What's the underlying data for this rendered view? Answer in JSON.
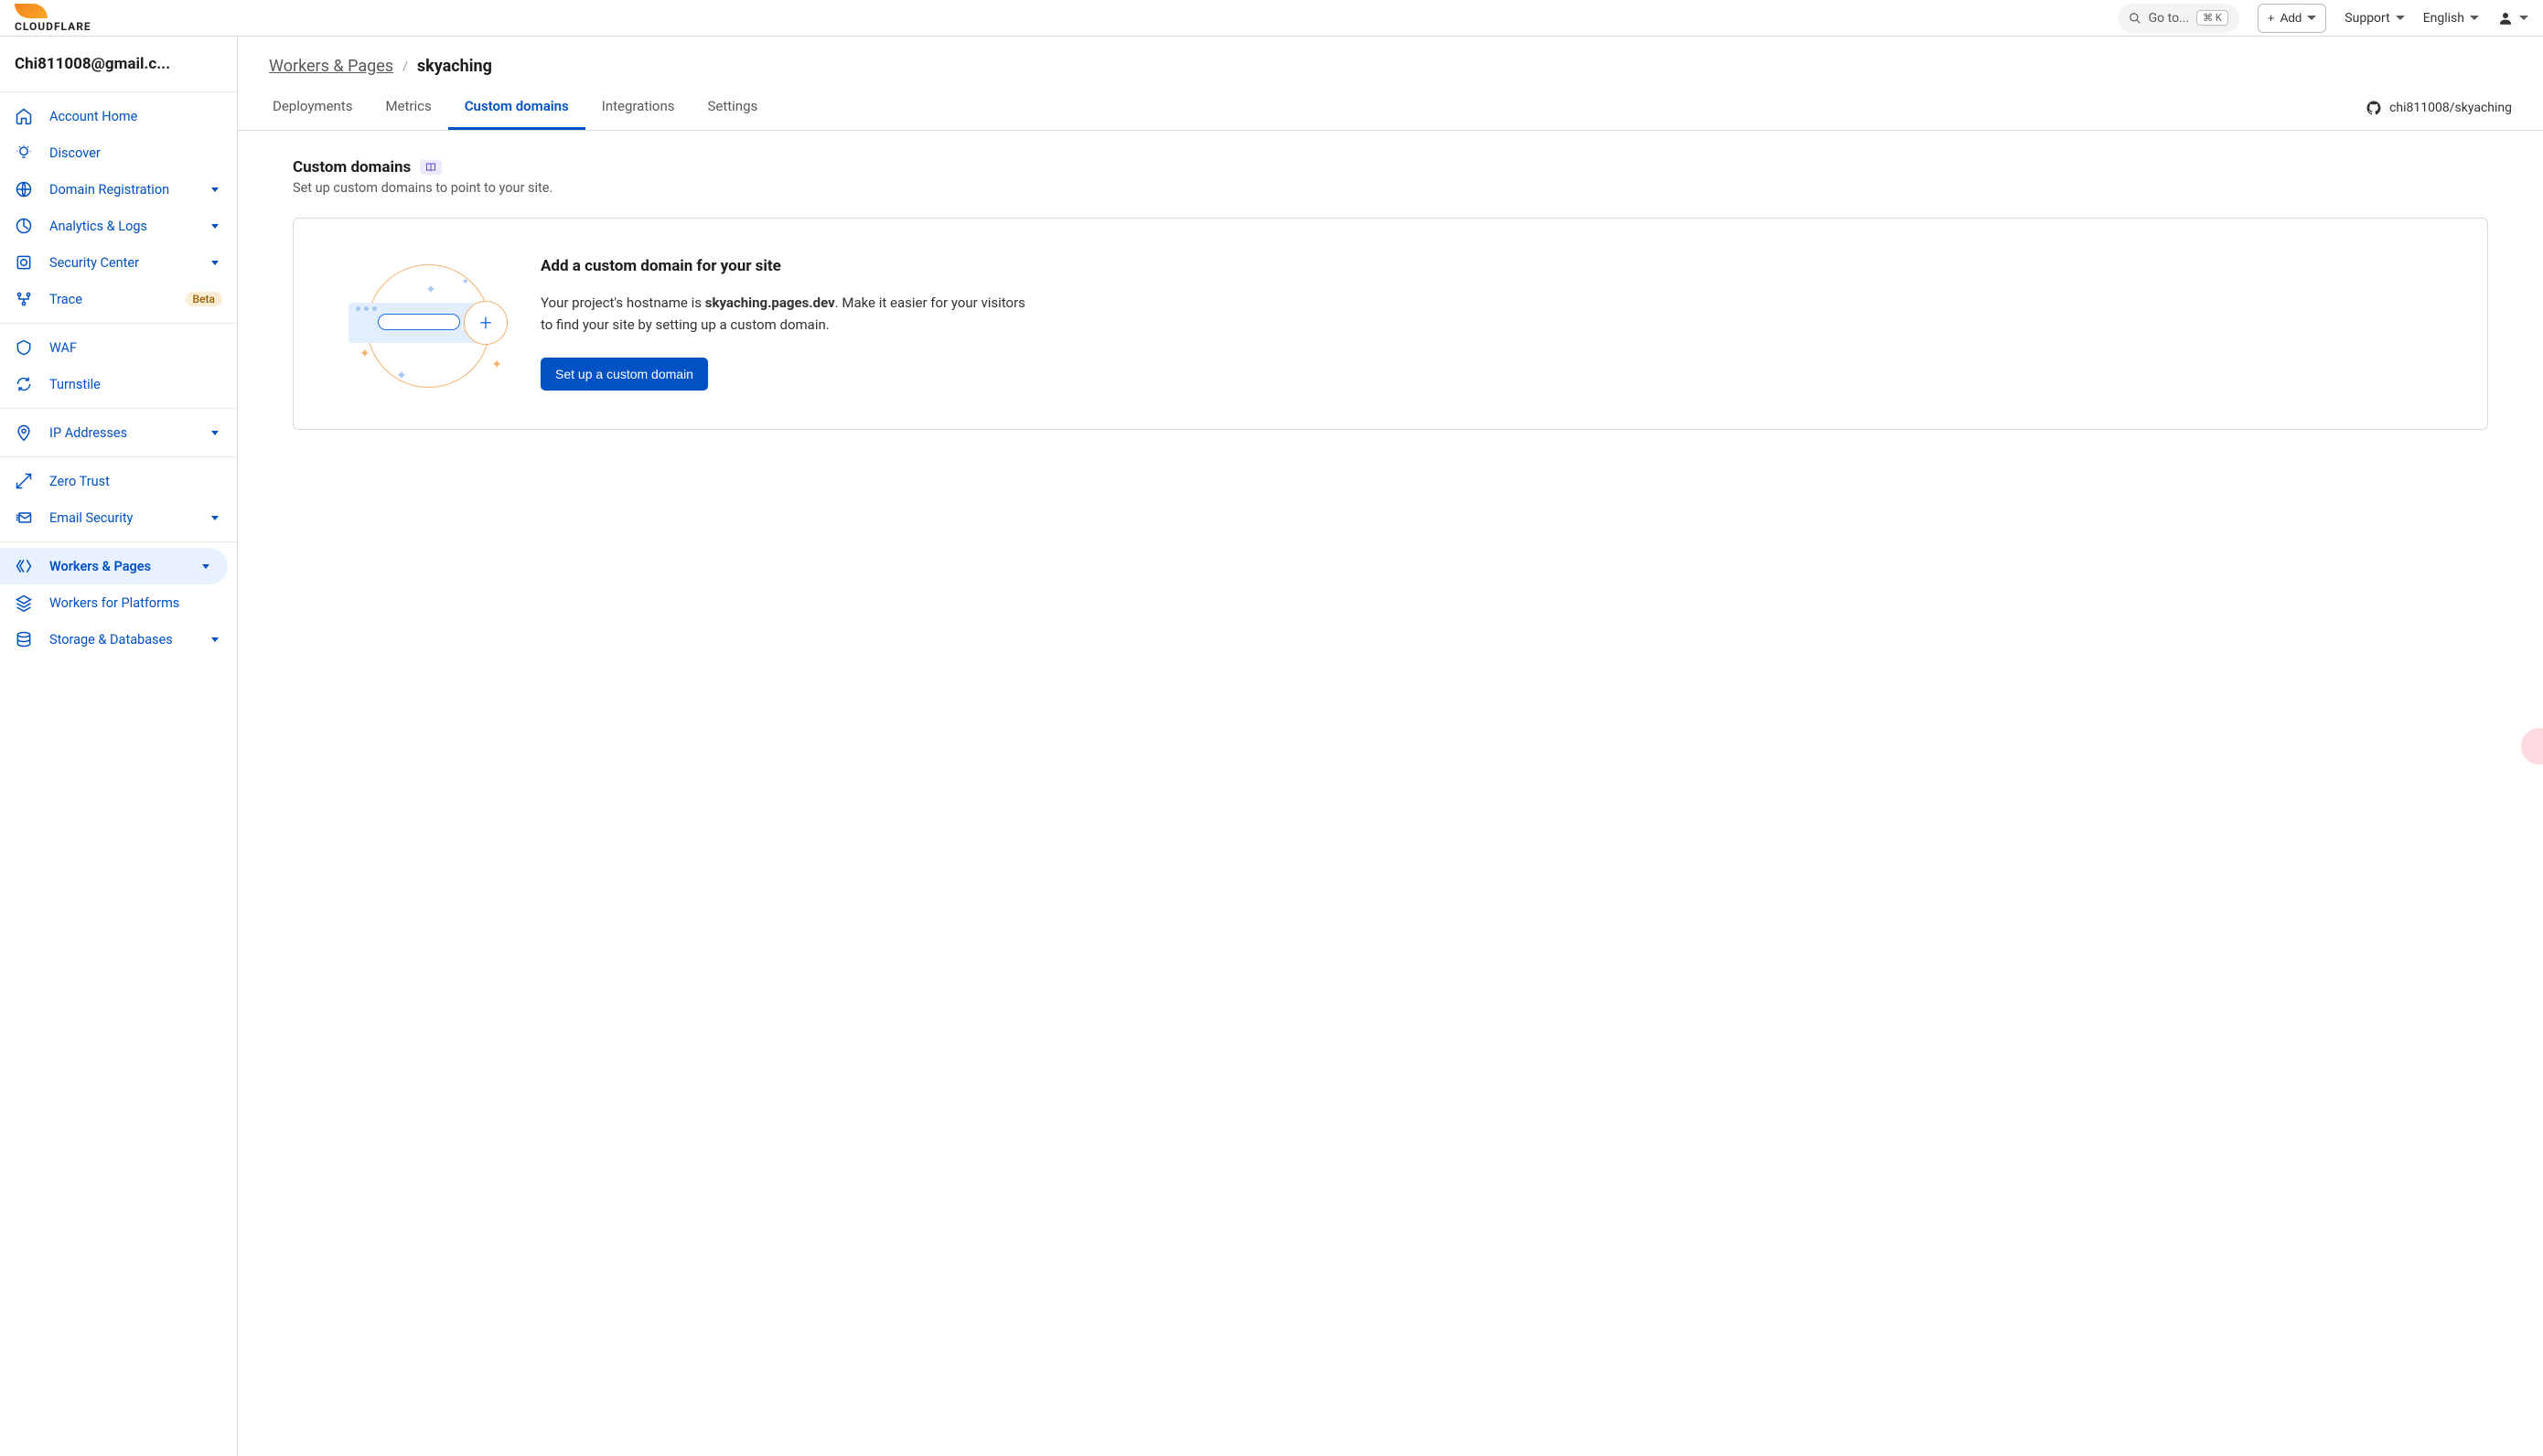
{
  "brand": "CLOUDFLARE",
  "topbar": {
    "search_placeholder": "Go to...",
    "kbd": "⌘ K",
    "add_label": "Add",
    "support_label": "Support",
    "language_label": "English"
  },
  "account_email": "Chi811008@gmail.c...",
  "sidebar_sections": [
    {
      "items": [
        {
          "icon": "home-icon",
          "label": "Account Home",
          "expandable": false
        },
        {
          "icon": "bulb-icon",
          "label": "Discover",
          "expandable": false
        },
        {
          "icon": "globe-icon",
          "label": "Domain Registration",
          "expandable": true
        },
        {
          "icon": "chart-icon",
          "label": "Analytics & Logs",
          "expandable": true
        },
        {
          "icon": "security-icon",
          "label": "Security Center",
          "expandable": true
        },
        {
          "icon": "trace-icon",
          "label": "Trace",
          "expandable": false,
          "badge": "Beta"
        }
      ]
    },
    {
      "items": [
        {
          "icon": "waf-icon",
          "label": "WAF",
          "expandable": false
        },
        {
          "icon": "turnstile-icon",
          "label": "Turnstile",
          "expandable": false
        }
      ]
    },
    {
      "items": [
        {
          "icon": "pin-icon",
          "label": "IP Addresses",
          "expandable": true
        }
      ]
    },
    {
      "items": [
        {
          "icon": "zerotrust-icon",
          "label": "Zero Trust",
          "expandable": false
        },
        {
          "icon": "email-icon",
          "label": "Email Security",
          "expandable": true
        }
      ]
    },
    {
      "items": [
        {
          "icon": "workers-icon",
          "label": "Workers & Pages",
          "expandable": true,
          "active": true
        },
        {
          "icon": "platforms-icon",
          "label": "Workers for Platforms",
          "expandable": false
        },
        {
          "icon": "storage-icon",
          "label": "Storage & Databases",
          "expandable": true
        }
      ]
    }
  ],
  "breadcrumb": {
    "parent": "Workers & Pages",
    "current": "skyaching"
  },
  "tabs": [
    {
      "label": "Deployments"
    },
    {
      "label": "Metrics"
    },
    {
      "label": "Custom domains",
      "active": true
    },
    {
      "label": "Integrations"
    },
    {
      "label": "Settings"
    }
  ],
  "repo": "chi811008/skyaching",
  "section": {
    "title": "Custom domains",
    "subtitle": "Set up custom domains to point to your site."
  },
  "card": {
    "heading": "Add a custom domain for your site",
    "desc_pre": "Your project's hostname is ",
    "hostname": "skyaching.pages.dev",
    "desc_post": ". Make it easier for your visitors to find your site by setting up a custom domain.",
    "cta": "Set up a custom domain"
  }
}
